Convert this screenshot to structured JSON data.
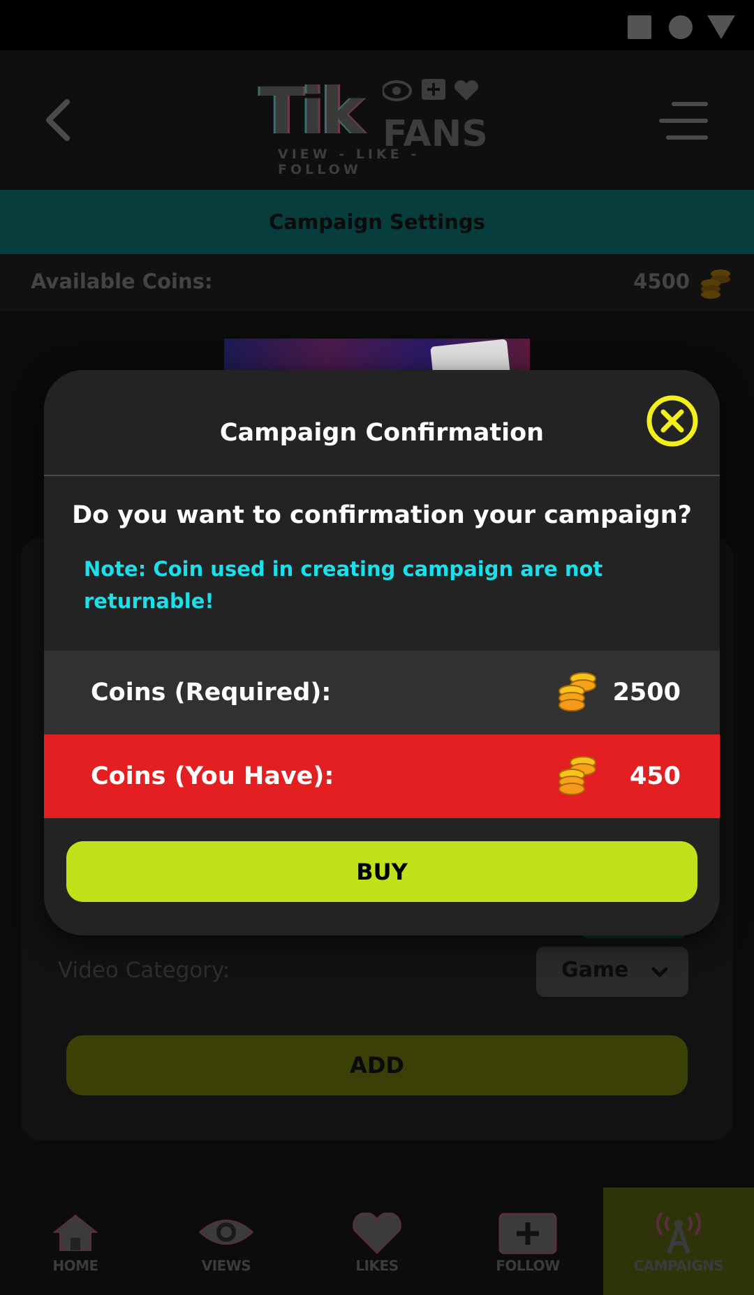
{
  "header": {
    "logo_tik": "Tik",
    "logo_fans": "FANS",
    "logo_tagline": "VIEW - LIKE - FOLLOW"
  },
  "campaign_bar": {
    "title": "Campaign Settings"
  },
  "coins_bar": {
    "label": "Available Coins:",
    "value": "4500"
  },
  "form": {
    "video_category_label": "Video Category:",
    "video_category_value": "Game",
    "add_label": "ADD"
  },
  "modal": {
    "title": "Campaign Confirmation",
    "question": "Do you want to confirmation your campaign?",
    "note": "Note: Coin used in creating campaign are not returnable!",
    "required_label": "Coins (Required):",
    "required_value": "2500",
    "have_label": "Coins (You Have):",
    "have_value": "450",
    "buy_label": "BUY"
  },
  "bottom_nav": {
    "items": [
      {
        "label": "HOME",
        "icon": "home-icon"
      },
      {
        "label": "VIEWS",
        "icon": "eye-icon"
      },
      {
        "label": "LIKES",
        "icon": "heart-icon"
      },
      {
        "label": "FOLLOW",
        "icon": "plus-box-icon"
      },
      {
        "label": "CAMPAIGNS",
        "icon": "broadcast-icon"
      }
    ],
    "active": "CAMPAIGNS"
  },
  "colors": {
    "accent_lime": "#c3e11a",
    "note_cyan": "#19e0ea",
    "warning_red": "#e41f22",
    "close_yellow": "#f3ef1d",
    "coin_orange": "#f7a21b"
  }
}
